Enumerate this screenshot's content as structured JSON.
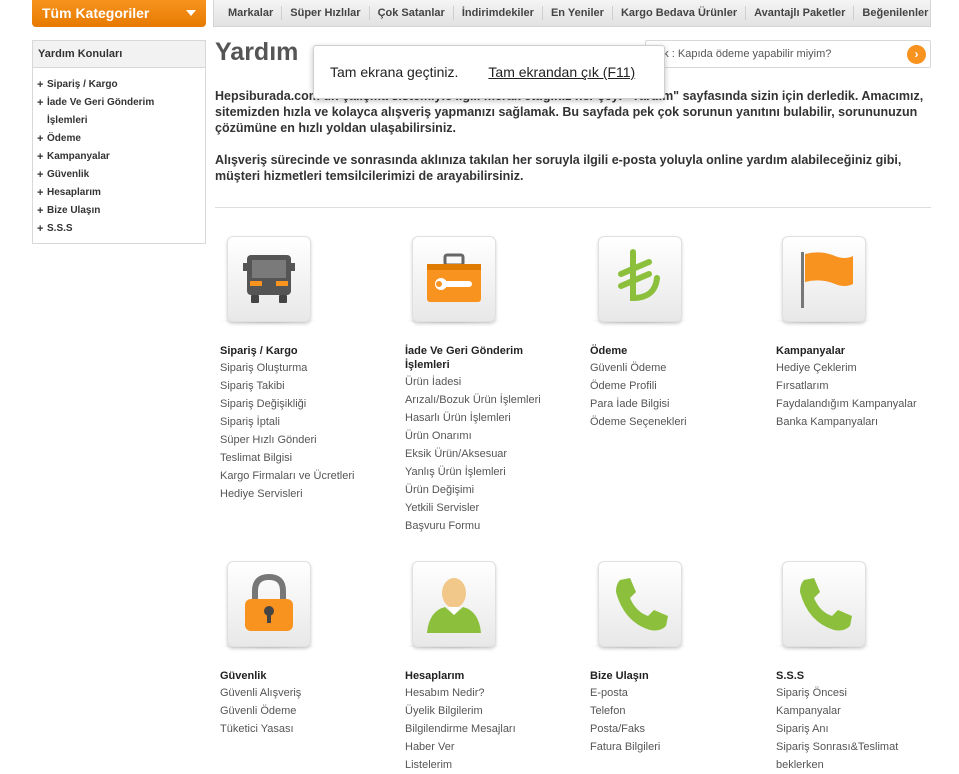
{
  "header": {
    "categories_label": "Tüm Kategoriler",
    "nav": [
      "Markalar",
      "Süper Hızlılar",
      "Çok Satanlar",
      "İndirimdekiler",
      "En Yeniler",
      "Kargo Bedava Ürünler",
      "Avantajlı Paketler",
      "Beğenilenler"
    ]
  },
  "sidebar": {
    "title": "Yardım Konuları",
    "items": [
      "Sipariş / Kargo",
      "İade Ve Geri Gönderim İşlemleri",
      "Ödeme",
      "Kampanyalar",
      "Güvenlik",
      "Hesaplarım",
      "Bize Ulaşın",
      "S.S.S"
    ]
  },
  "main": {
    "title": "Yardım",
    "search_placeholder": "nek : Kapıda ödeme yapabilir miyim?",
    "intro": [
      "Hepsiburada.com un çalışma sistemiyle ilgili merak ettiğiniz her şeyi \"Yardım\" sayfasında sizin için derledik. Amacımız, sitemizden hızla ve kolayca alışveriş yapmanızı sağlamak. Bu sayfada pek çok sorunun yanıtını bulabilir, sorununuzun çözümüne en hızlı yoldan ulaşabilirsiniz.",
      "Alışveriş sürecinde ve sonrasında aklınıza takılan her soruyla ilgili e-posta yoluyla online yardım alabileceğiniz gibi, müşteri hizmetleri temsilcilerimizi de arayabilirsiniz."
    ]
  },
  "popup": {
    "message": "Tam ekrana geçtiniz.",
    "exit_label": "Tam ekrandan çık (F11)"
  },
  "sections": [
    {
      "title": "Sipariş / Kargo",
      "icon": "truck-icon",
      "links": [
        "Sipariş Oluşturma",
        "Sipariş Takibi",
        "Sipariş Değişikliği",
        "Sipariş İptali",
        "Süper Hızlı Gönderi",
        "Teslimat Bilgisi",
        "Kargo Firmaları ve Ücretleri",
        "Hediye Servisleri"
      ]
    },
    {
      "title": "İade Ve Geri Gönderim İşlemleri",
      "icon": "toolbox-icon",
      "links": [
        "Ürün İadesi",
        "Arızalı/Bozuk Ürün İşlemleri",
        "Hasarlı Ürün İşlemleri",
        "Ürün Onarımı",
        "Eksik Ürün/Aksesuar",
        "Yanlış Ürün İşlemleri",
        "Ürün Değişimi",
        "Yetkili Servisler",
        "Başvuru Formu"
      ]
    },
    {
      "title": "Ödeme",
      "icon": "lira-icon",
      "links": [
        "Güvenli Ödeme",
        "Ödeme Profili",
        "Para İade Bilgisi",
        "Ödeme Seçenekleri"
      ]
    },
    {
      "title": "Kampanyalar",
      "icon": "flag-icon",
      "links": [
        "Hediye Çeklerim",
        "Fırsatlarım",
        "Faydalandığım Kampanyalar",
        "Banka Kampanyaları"
      ]
    },
    {
      "title": "Güvenlik",
      "icon": "lock-icon",
      "links": [
        "Güvenli Alışveriş",
        "Güvenli Ödeme",
        "Tüketici Yasası"
      ]
    },
    {
      "title": "Hesaplarım",
      "icon": "user-icon",
      "links": [
        "Hesabım Nedir?",
        "Üyelik Bilgilerim",
        "Bilgilendirme Mesajları",
        "Haber Ver",
        "Listelerim"
      ]
    },
    {
      "title": "Bize Ulaşın",
      "icon": "phone-icon",
      "links": [
        "E-posta",
        "Telefon",
        "Posta/Faks",
        "Fatura Bilgileri"
      ]
    },
    {
      "title": "S.S.S",
      "icon": "phone-icon",
      "links": [
        "Sipariş Öncesi",
        "Kampanyalar",
        "Sipariş Anı",
        "Sipariş Sonrası&Teslimat",
        "beklerken"
      ]
    }
  ],
  "colors": {
    "accent": "#f7931e",
    "green": "#8bbf3c"
  }
}
